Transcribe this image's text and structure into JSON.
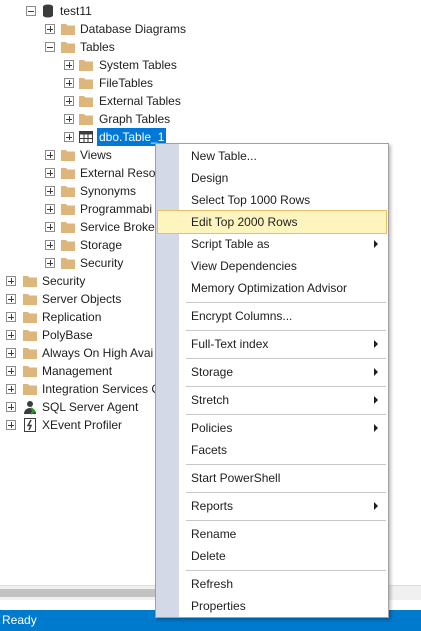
{
  "tree": {
    "db_name": "test11",
    "db_children": [
      "Database Diagrams",
      "Tables"
    ],
    "tables_children": [
      "System Tables",
      "FileTables",
      "External Tables",
      "Graph Tables"
    ],
    "selected_table": "dbo.Table_1",
    "db_children_rest": [
      "Views",
      "External Resou",
      "Synonyms",
      "Programmabi",
      "Service Broker",
      "Storage",
      "Security"
    ],
    "server_nodes": [
      "Security",
      "Server Objects",
      "Replication",
      "PolyBase",
      "Always On High Avai",
      "Management",
      "Integration Services C"
    ],
    "agent_label": "SQL Server Agent",
    "xevent_label": "XEvent Profiler"
  },
  "context_menu": {
    "items": [
      {
        "label": "New Table..."
      },
      {
        "label": "Design"
      },
      {
        "label": "Select Top 1000 Rows"
      },
      {
        "label": "Edit Top 2000 Rows",
        "highlighted": true
      },
      {
        "label": "Script Table as",
        "submenu": true
      },
      {
        "label": "View Dependencies"
      },
      {
        "label": "Memory Optimization Advisor"
      },
      {
        "label": "Encrypt Columns..."
      },
      {
        "label": "Full-Text index",
        "submenu": true
      },
      {
        "label": "Storage",
        "submenu": true
      },
      {
        "label": "Stretch",
        "submenu": true
      },
      {
        "label": "Policies",
        "submenu": true
      },
      {
        "label": "Facets"
      },
      {
        "label": "Start PowerShell"
      },
      {
        "label": "Reports",
        "submenu": true
      },
      {
        "label": "Rename"
      },
      {
        "label": "Delete"
      },
      {
        "label": "Refresh"
      },
      {
        "label": "Properties"
      }
    ]
  },
  "status_bar": {
    "text": "Ready"
  },
  "colors": {
    "accent": "#007acc",
    "selection": "#0078d7",
    "menu_highlight": "#fdf4bf",
    "folder": "#dcb67a"
  }
}
